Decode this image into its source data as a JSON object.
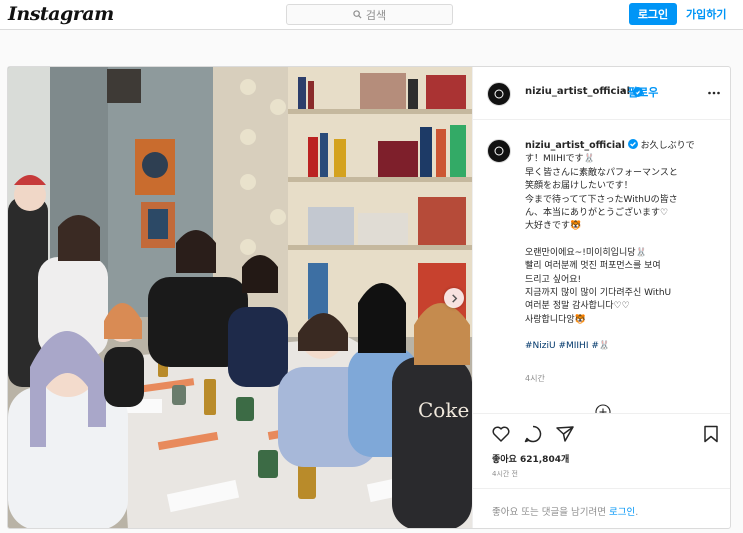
{
  "nav": {
    "logo": "Instagram",
    "search_placeholder": "검색",
    "login_label": "로그인",
    "signup_label": "가입하기"
  },
  "post": {
    "username": "niziu_artist_official",
    "follow_separator": "•",
    "follow_label": "팔로우",
    "caption_lines": [
      "お久しぶりで",
      "す！MIIHIです🐰",
      "早く皆さんに素敵なパフォーマンスと",
      "笑顔をお届けしたいです！",
      "今まで待ってて下さったWithUの皆さ",
      "ん、本当にありがとうございます♡",
      "大好きです🐯",
      "",
      "오랜만이에요~!미이히입니당🐰",
      "빨리 여러분께 멋진 퍼포먼스를 보여",
      "드리고 싶어요!",
      "지금까지 많이 많이 기다려주신 WithU",
      "여러분 정말 감사합니다♡♡",
      "사랑합니다앙🐯"
    ],
    "hashtags": "#NiziU #MIIHI #🐰",
    "caption_time": "4시간",
    "likes": "좋아요 621,804개",
    "post_time": "4시간 전",
    "login_prompt_prefix": "좋아요 또는 댓글을 남기려면 ",
    "login_prompt_link": "로그인",
    "login_prompt_suffix": "."
  },
  "colors": {
    "accent": "#0095f6",
    "border": "#dbdbdb",
    "text": "#262626",
    "muted": "#8e8e8e",
    "hashtag": "#00376b"
  }
}
